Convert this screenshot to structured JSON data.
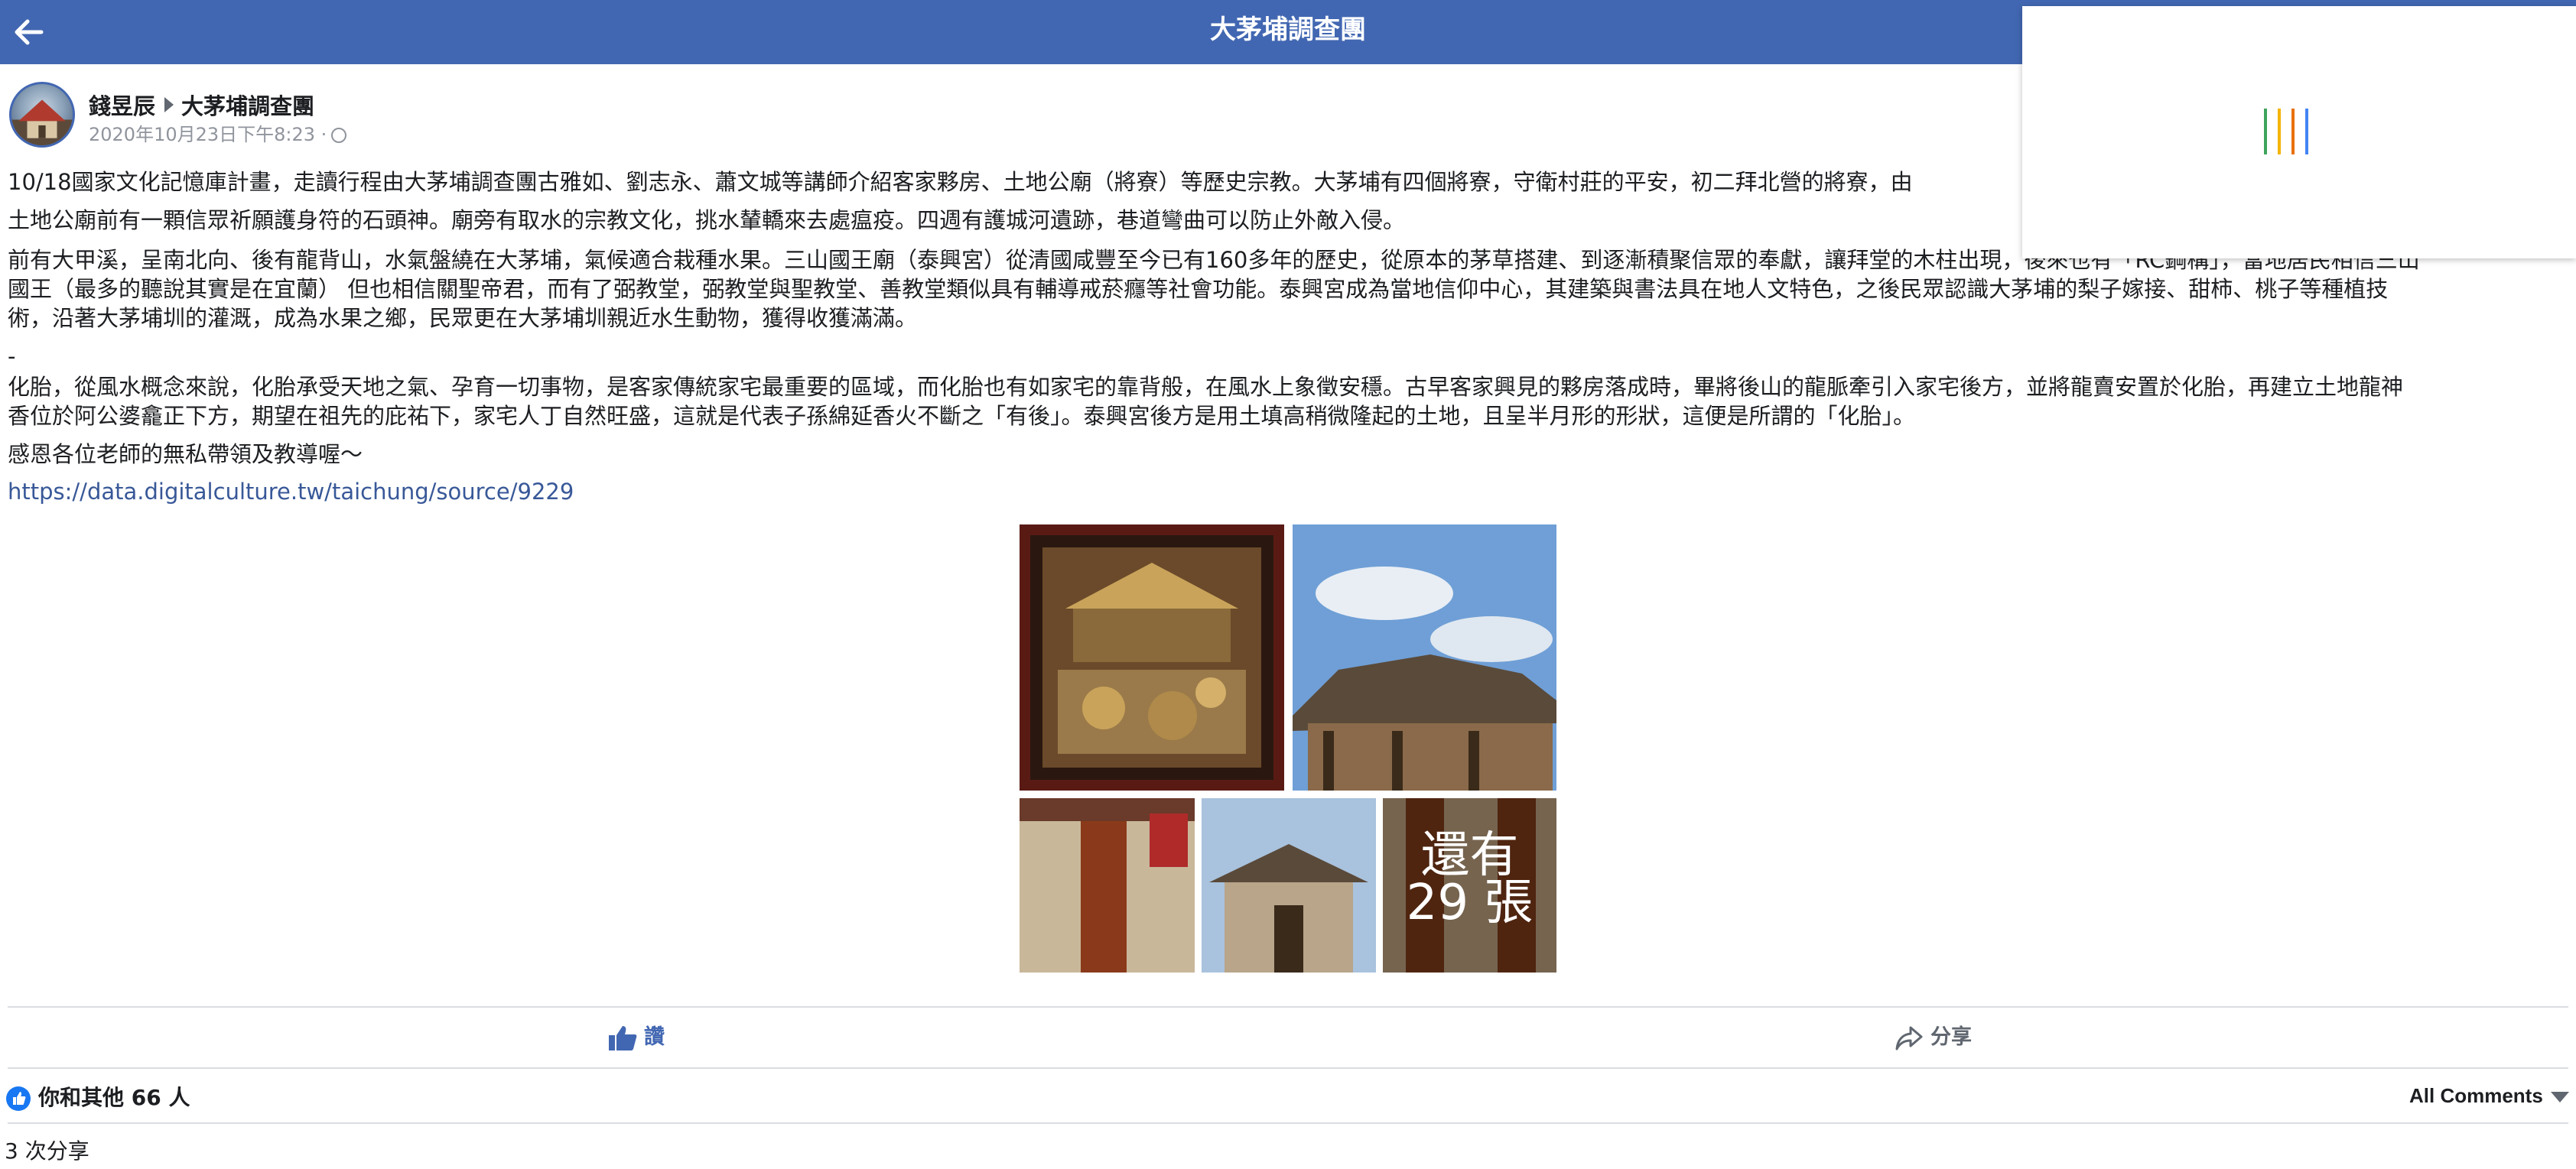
{
  "header": {
    "title": "大茅埔調查團"
  },
  "loader": {
    "bar_colors": [
      "#3ea55c",
      "#f5b400",
      "#e8710a",
      "#4285f4"
    ]
  },
  "post": {
    "author": "錢昱辰",
    "group": "大茅埔調查團",
    "timestamp": "2020年10月23日下午8:23 ·",
    "paragraphs": [
      "10/18國家文化記憶庫計畫，走讀行程由大茅埔調查團古雅如、劉志永、蕭文城等講師介紹客家夥房、土地公廟（將寮）等歷史宗教。大茅埔有四個將寮，守衛村莊的平安，初二拜北營的將寮，由",
      "土地公廟前有一顆信眾祈願護身符的石頭神。廟旁有取水的宗教文化，挑水輦轎來去處瘟疫。四週有護城河遺跡，巷道彎曲可以防止外敵入侵。",
      "前有大甲溪，呈南北向、後有龍背山，水氣盤繞在大茅埔，氣候適合栽種水果。三山國王廟（泰興宮）從清國咸豐至今已有160多年的歷史，從原本的茅草搭建、到逐漸積聚信眾的奉獻，讓拜堂的木柱出現，後來也有「RC鋼構」，當地居民相信三山",
      "國王（最多的聽說其實是在宜蘭） 但也相信關聖帝君，而有了弼教堂，弼教堂與聖教堂、善教堂類似具有輔導戒菸癮等社會功能。泰興宮成為當地信仰中心，其建築與書法具在地人文特色，之後民眾認識大茅埔的梨子嫁接、甜柿、桃子等種植技",
      "術，沿著大茅埔圳的灌溉，成為水果之鄉，民眾更在大茅埔圳親近水生動物，獲得收獲滿滿。",
      "-",
      "化胎，從風水概念來說，化胎承受天地之氣、孕育一切事物，是客家傳統家宅最重要的區域，而化胎也有如家宅的靠背般，在風水上象徵安穩。古早客家興見的夥房落成時，畢將後山的龍脈牽引入家宅後方，並將龍賣安置於化胎，再建立土地龍神",
      "香位於阿公婆龕正下方，期望在祖先的庇祐下，家宅人丁自然旺盛，這就是代表子孫綿延香火不斷之「有後」。泰興宮後方是用土填高稍微隆起的土地，且呈半月形的形狀，這便是所謂的「化胎」。",
      "感恩各位老師的無私帶領及教導喔～"
    ],
    "link": "https://data.digitalculture.tw/taichung/source/9229",
    "more_photos": "還有 29 張"
  },
  "actions": {
    "like": "讚",
    "share": "分享"
  },
  "footer": {
    "likes": "你和其他 66 人",
    "all_comments": "All Comments",
    "shares": "3 次分享"
  }
}
